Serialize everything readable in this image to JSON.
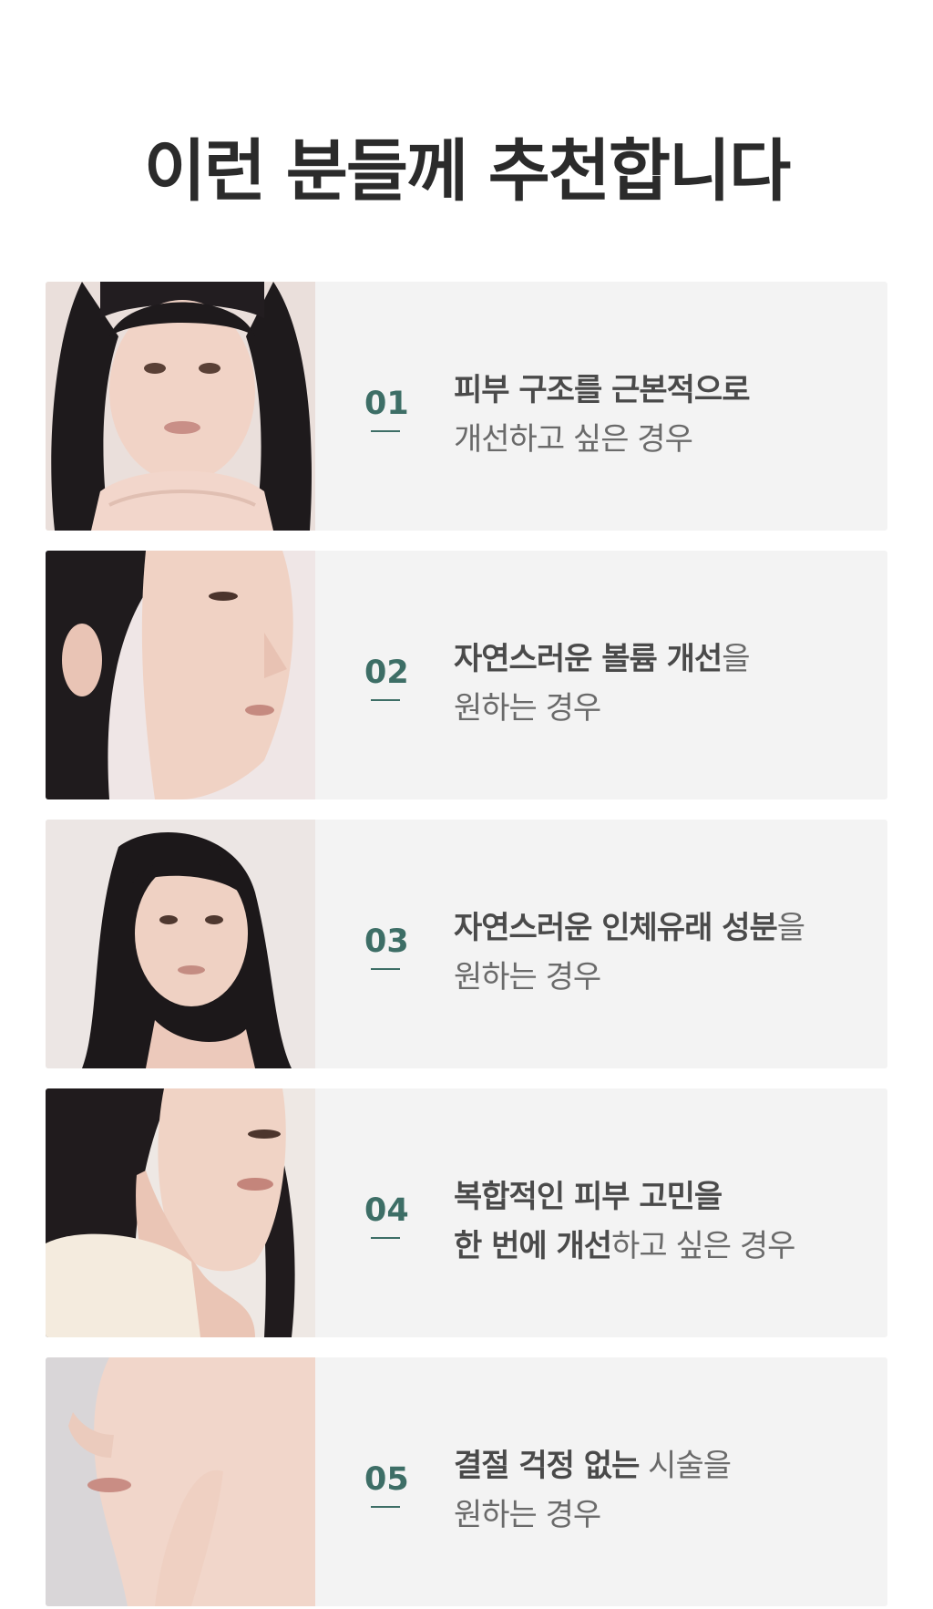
{
  "title": "이런 분들께 추천합니다",
  "items": [
    {
      "number": "01",
      "line1_bold": "피부 구조를 근본적으로",
      "line1_rest": "",
      "line2_bold": "",
      "line2_rest": "개선하고 싶은 경우"
    },
    {
      "number": "02",
      "line1_bold": "자연스러운 볼륨 개선",
      "line1_rest": "을",
      "line2_bold": "",
      "line2_rest": "원하는 경우"
    },
    {
      "number": "03",
      "line1_bold": "자연스러운 인체유래 성분",
      "line1_rest": "을",
      "line2_bold": "",
      "line2_rest": "원하는 경우"
    },
    {
      "number": "04",
      "line1_bold": "복합적인 피부 고민을",
      "line1_rest": "",
      "line2_bold": "한 번에 개선",
      "line2_rest": "하고 싶은 경우"
    },
    {
      "number": "05",
      "line1_bold": "결절 걱정 없는",
      "line1_rest": " 시술을",
      "line2_bold": "",
      "line2_rest": "원하는 경우"
    }
  ],
  "colors": {
    "accent": "#3d6e66",
    "card_bg": "#f3f3f3",
    "title": "#2b2b2b"
  }
}
